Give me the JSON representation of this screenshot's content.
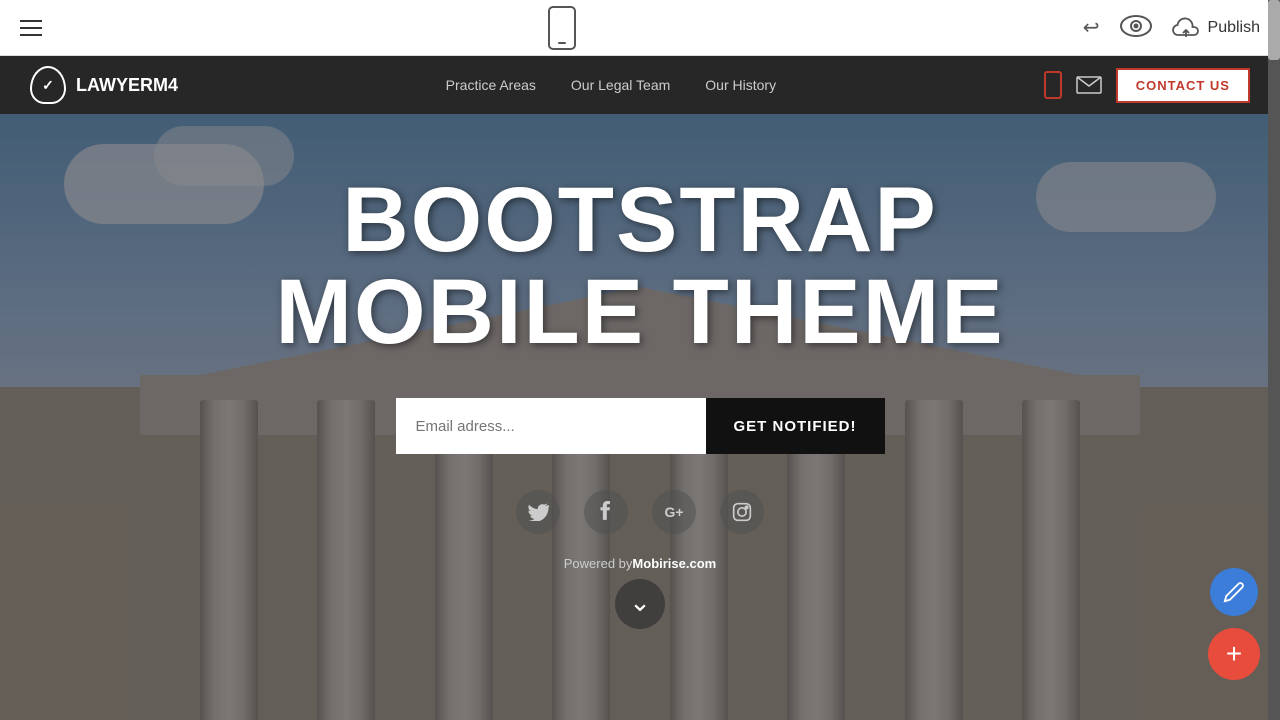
{
  "toolbar": {
    "publish_label": "Publish",
    "undo_symbol": "↩",
    "phone_preview_title": "Mobile Preview"
  },
  "navbar": {
    "brand": "LAWYERM4",
    "nav_links": [
      {
        "label": "Practice Areas"
      },
      {
        "label": "Our Legal Team"
      },
      {
        "label": "Our History"
      }
    ],
    "contact_button": "CONTACT US"
  },
  "hero": {
    "title_line1": "BOOTSTRAP",
    "title_line2": "MOBILE THEME",
    "email_placeholder": "Email adress...",
    "notify_button": "GET NOTIFIED!",
    "powered_by": "Powered by",
    "powered_site": "Mobirise.com",
    "social": [
      {
        "name": "twitter",
        "symbol": "𝕏"
      },
      {
        "name": "facebook",
        "symbol": "f"
      },
      {
        "name": "google-plus",
        "symbol": "G+"
      },
      {
        "name": "instagram",
        "symbol": "◎"
      }
    ]
  },
  "fab": {
    "pencil_label": "✎",
    "plus_label": "+"
  }
}
